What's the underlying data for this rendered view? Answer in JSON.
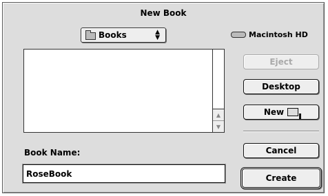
{
  "dialog": {
    "title": "New Book"
  },
  "location_popup": {
    "selected": "Books",
    "icon": "folder-icon"
  },
  "volume": {
    "label": "Macintosh HD",
    "icon": "hard-disk-icon"
  },
  "file_list": {
    "items": []
  },
  "buttons": {
    "eject": "Eject",
    "desktop": "Desktop",
    "new": "New",
    "cancel": "Cancel",
    "create": "Create"
  },
  "book_name": {
    "label": "Book Name:",
    "value": "RoseBook"
  }
}
